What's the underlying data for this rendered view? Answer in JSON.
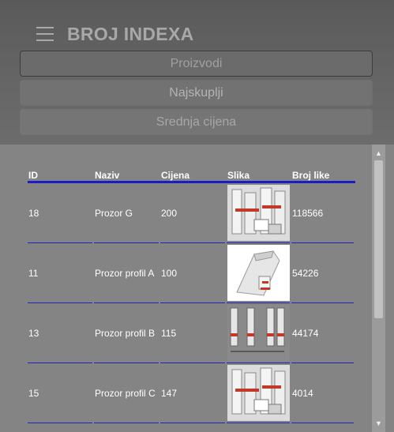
{
  "header": {
    "title": "BROJ INDEXA",
    "nav": [
      "Proizvodi",
      "Najskuplji",
      "Srednja cijena"
    ]
  },
  "table": {
    "columns": [
      "ID",
      "Naziv",
      "Cijena",
      "Slika",
      "Broj like"
    ],
    "rows": [
      {
        "id": "18",
        "name": "Prozor G",
        "price": "200",
        "image": "window-profile-set-image",
        "likes": "118566"
      },
      {
        "id": "11",
        "name": "Prozor profil A",
        "price": "100",
        "image": "window-profile-corner-image",
        "likes": "54226"
      },
      {
        "id": "13",
        "name": "Prozor profil B",
        "price": "115",
        "image": "window-profile-sections-image",
        "likes": "44174"
      },
      {
        "id": "15",
        "name": "Prozor profil C",
        "price": "147",
        "image": "window-profile-set-image",
        "likes": "4014"
      }
    ]
  },
  "icons": {
    "menu": "hamburger-menu-icon",
    "scroll_up": "scroll-up-arrow-icon",
    "scroll_down": "scroll-down-arrow-icon"
  },
  "colors": {
    "header_bg": "#606060",
    "content_bg": "#848484",
    "table_rule": "#1b1bc8",
    "text": "#ffffff"
  }
}
